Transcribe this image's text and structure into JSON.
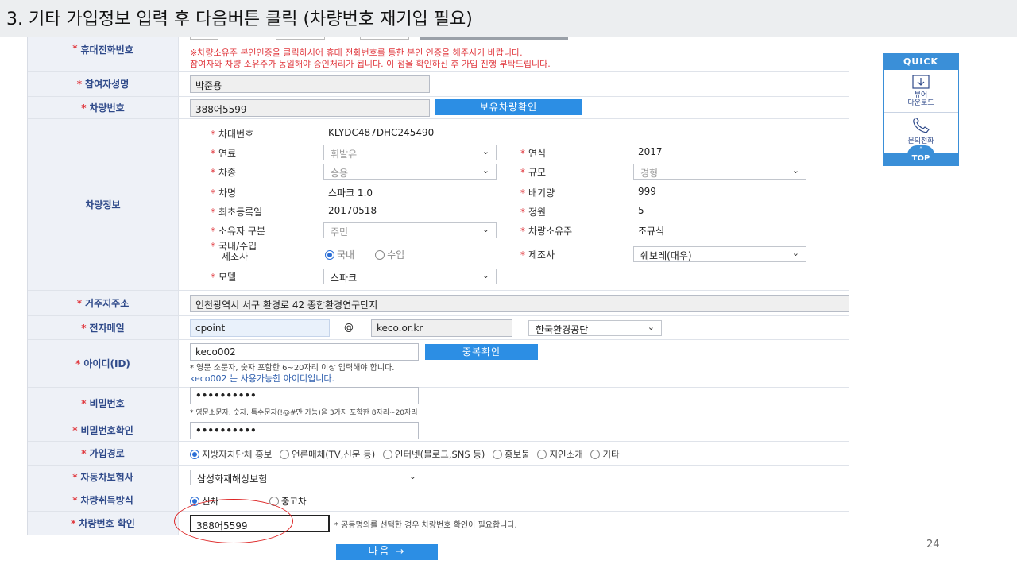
{
  "slide": {
    "title": "3. 기타 가입정보 입력 후 다음버튼 클릭 (차량번호 재기입 필요)",
    "page_number": "24"
  },
  "phone": {
    "label": "휴대전화번호",
    "notice1": "※차량소유주 본인인증을 클릭하시어 휴대 전화번호를 통한 본인 인증을 해주시기 바랍니다.",
    "notice2": "참여자와 차량 소유주가 동일해야 승인처리가 됩니다. 이 점을 확인하신 후 가입 진행 부탁드립니다."
  },
  "participant": {
    "label": "참여자성명",
    "value": "박준용"
  },
  "car_number": {
    "label": "차량번호",
    "value": "388어5599",
    "button": "보유차량확인"
  },
  "vehicle": {
    "label": "차량정보",
    "vin_label": "차대번호",
    "vin": "KLYDC487DHC245490",
    "fuel_label": "연료",
    "fuel": "휘발유",
    "year_label": "연식",
    "year": "2017",
    "type_label": "차종",
    "type": "승용",
    "scale_label": "규모",
    "scale": "경형",
    "name_label": "차명",
    "name": "스파크 1.0",
    "cc_label": "배기량",
    "cc": "999",
    "reg_label": "최초등록일",
    "reg": "20170518",
    "seat_label": "정원",
    "seat": "5",
    "owner_type_label": "소유자 구분",
    "owner_type": "주민",
    "owner_label": "차량소유주",
    "owner": "조규식",
    "origin_label1": "국내/수입",
    "origin_label2": "제조사",
    "origin_domestic": "국내",
    "origin_import": "수입",
    "maker_label": "제조사",
    "maker": "쉐보레(대우)",
    "model_label": "모델",
    "model": "스파크"
  },
  "address": {
    "label": "거주지주소",
    "value": "인천광역시 서구 환경로 42 종합환경연구단지"
  },
  "email": {
    "label": "전자메일",
    "id": "cpoint",
    "at": "@",
    "domain": "keco.or.kr",
    "select": "한국환경공단"
  },
  "userid": {
    "label": "아이디(ID)",
    "value": "keco002",
    "button": "중복확인",
    "hint": "* 영문 소문자, 숫자 포함한 6~20자리 이상 입력해야 합니다.",
    "ok": "keco002 는 사용가능한 아이디입니다."
  },
  "password": {
    "label": "비밀번호",
    "value": "••••••••••",
    "hint": "* 영문소문자, 숫자, 특수문자(!@#만 가능)을 3가지 포함한 8자리~20자리"
  },
  "password_confirm": {
    "label": "비밀번호확인",
    "value": "••••••••••"
  },
  "join_route": {
    "label": "가입경로",
    "options": [
      "지방자치단체 홍보",
      "언론매체(TV,신문 등)",
      "인터넷(블로그,SNS 등)",
      "홍보물",
      "지인소개",
      "기타"
    ]
  },
  "insurance": {
    "label": "자동차보험사",
    "value": "삼성화재해상보험"
  },
  "acquire": {
    "label": "차량취득방식",
    "new": "신차",
    "used": "중고차"
  },
  "car_confirm": {
    "label": "차량번호 확인",
    "value": "388어5599",
    "hint": "* 공동명의를 선택한 경우 차량번호 확인이 필요합니다."
  },
  "next_button": "다음 →",
  "quick": {
    "title": "QUICK",
    "viewer1": "뷰어",
    "viewer2": "다운로드",
    "call": "문의전화",
    "top": "TOP"
  },
  "colors": {
    "accent": "#2c8ee4",
    "label_bg": "#eef1f7",
    "required": "#e0383e",
    "annotation": "#dd2222"
  }
}
